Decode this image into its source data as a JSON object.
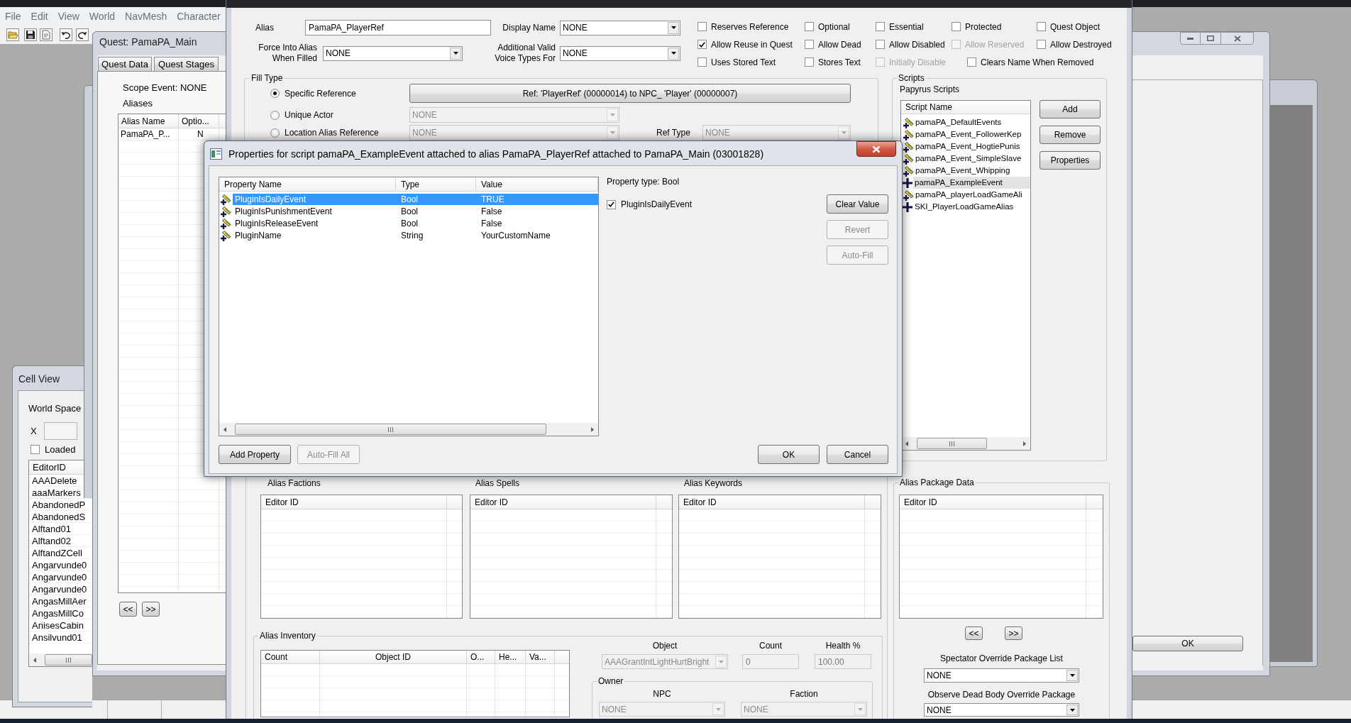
{
  "main_window": {
    "menu": [
      "File",
      "Edit",
      "View",
      "World",
      "NavMesh",
      "Character"
    ]
  },
  "cell_view": {
    "title": "Cell View",
    "world_space_label": "World Space",
    "x_label": "X",
    "loaded_checkbox": {
      "label": "Loaded",
      "checked": false
    },
    "list": {
      "column": "EditorID",
      "rows": [
        "AAADelete",
        "aaaMarkers",
        "AbandonedP",
        "AbandonedS",
        "Alftand01",
        "Alftand02",
        "AlftandZCell",
        "Angarvunde0",
        "Angarvunde0",
        "Angarvunde0",
        "AngasMillAer",
        "AngasMillCo",
        "AnisesCabin",
        "Ansilvund01"
      ]
    }
  },
  "quest_window": {
    "title": "Quest: PamaPA_Main",
    "tabs": [
      {
        "label": "Quest Data",
        "selected": false
      },
      {
        "label": "Quest Stages",
        "selected": false
      }
    ],
    "scope_event": "Scope Event: NONE",
    "aliases_label": "Aliases",
    "aliases_table": {
      "columns": [
        "Alias Name",
        "Optio..."
      ],
      "rows": [
        [
          "PamaPA_P...",
          "N"
        ]
      ]
    },
    "nav_buttons": [
      "<<",
      ">>"
    ],
    "ok_button": "OK"
  },
  "alias_window": {
    "alias": {
      "label": "Alias",
      "value": "PamaPA_PlayerRef"
    },
    "display_name": {
      "label": "Display Name",
      "value": "NONE",
      "disabled": false
    },
    "force_into_alias": {
      "label_lines": [
        "Force Into Alias",
        "When Filled"
      ],
      "value": "NONE",
      "disabled": false
    },
    "voice_types": {
      "label_lines": [
        "Additional Valid",
        "Voice Types For"
      ],
      "value": "NONE",
      "disabled": false
    },
    "flags": [
      [
        {
          "label": "Reserves Reference",
          "checked": false,
          "disabled": false
        },
        {
          "label": "Optional",
          "checked": false,
          "disabled": false
        },
        {
          "label": "Essential",
          "checked": false,
          "disabled": false
        },
        {
          "label": "Protected",
          "checked": false,
          "disabled": false
        },
        {
          "label": "Quest Object",
          "checked": false,
          "disabled": false
        }
      ],
      [
        {
          "label": "Allow Reuse in Quest",
          "checked": true,
          "disabled": false
        },
        {
          "label": "Allow Dead",
          "checked": false,
          "disabled": false
        },
        {
          "label": "Allow Disabled",
          "checked": false,
          "disabled": false
        },
        {
          "label": "Allow Reserved",
          "checked": false,
          "disabled": true
        },
        {
          "label": "Allow Destroyed",
          "checked": false,
          "disabled": false
        }
      ],
      [
        {
          "label": "Uses Stored Text",
          "checked": false,
          "disabled": false
        },
        {
          "label": "Stores Text",
          "checked": false,
          "disabled": false
        },
        {
          "label": "Initially Disable",
          "checked": false,
          "disabled": true
        },
        {
          "label": "Clears Name When Removed",
          "checked": false,
          "disabled": false
        }
      ]
    ],
    "fill_type": {
      "title": "Fill Type",
      "options": [
        {
          "label": "Specific Reference",
          "selected": true,
          "control": {
            "kind": "button",
            "text": "Ref: 'PlayerRef' (00000014) to NPC_ 'Player' (00000007)"
          }
        },
        {
          "label": "Unique Actor",
          "selected": false,
          "control": {
            "kind": "combo",
            "value": "NONE",
            "disabled": true
          }
        },
        {
          "label": "Location Alias Reference",
          "selected": false,
          "control": {
            "kind": "combo",
            "value": "NONE",
            "disabled": true
          },
          "ref_type": {
            "label": "Ref Type",
            "value": "NONE",
            "disabled": true
          }
        }
      ]
    },
    "scripts": {
      "title": "Scripts",
      "subtitle": "Papyrus Scripts",
      "column": "Script Name",
      "items": [
        {
          "name": "pamaPA_DefaultEvents",
          "properties_set": true,
          "selected": false
        },
        {
          "name": "pamaPA_Event_FollowerKep",
          "properties_set": true,
          "selected": false
        },
        {
          "name": "pamaPA_Event_HogtiePunis",
          "properties_set": true,
          "selected": false
        },
        {
          "name": "pamaPA_Event_SimpleSlave",
          "properties_set": true,
          "selected": false
        },
        {
          "name": "pamaPA_Event_Whipping",
          "properties_set": true,
          "selected": false
        },
        {
          "name": "pamaPA_ExampleEvent",
          "properties_set": false,
          "selected": true
        },
        {
          "name": "pamaPA_playerLoadGameAli",
          "properties_set": true,
          "selected": false
        },
        {
          "name": "SKI_PlayerLoadGameAlias",
          "properties_set": false,
          "selected": false
        }
      ],
      "buttons": [
        "Add",
        "Remove",
        "Properties"
      ]
    },
    "factions": {
      "label": "Alias Factions",
      "column": "Editor ID"
    },
    "spells": {
      "label": "Alias Spells",
      "column": "Editor ID"
    },
    "keywords": {
      "label": "Alias Keywords",
      "column": "Editor ID"
    },
    "inventory": {
      "title": "Alias Inventory",
      "columns": [
        "Count",
        "Object ID",
        "O...",
        "He...",
        "Va..."
      ],
      "object": {
        "label": "Object",
        "value": "AAAGrantIntLightHurtBright",
        "disabled": true
      },
      "count": {
        "label": "Count",
        "value": "0",
        "disabled": true
      },
      "health": {
        "label": "Health %",
        "value": "100.00",
        "disabled": true
      },
      "owner": {
        "title": "Owner",
        "npc": {
          "label": "NPC",
          "value": "NONE",
          "disabled": true
        },
        "faction": {
          "label": "Faction",
          "value": "NONE",
          "disabled": true
        }
      }
    },
    "package_data": {
      "title": "Alias Package Data",
      "column": "Editor ID",
      "nav_buttons": [
        "<<",
        ">>"
      ],
      "spectator": {
        "label": "Spectator Override Package List",
        "value": "NONE",
        "disabled": false
      },
      "observe": {
        "label": "Observe Dead Body Override Package",
        "value": "NONE",
        "disabled": false
      }
    }
  },
  "properties_dialog": {
    "title": "Properties for script pamaPA_ExampleEvent attached to alias PamaPA_PlayerRef attached to PamaPA_Main (03001828)",
    "columns": [
      "Property Name",
      "Type",
      "Value"
    ],
    "rows": [
      {
        "name": "PluginIsDailyEvent",
        "type": "Bool",
        "value": "TRUE",
        "selected": true,
        "value_set": true
      },
      {
        "name": "PluginIsPunishmentEvent",
        "type": "Bool",
        "value": "False",
        "selected": false,
        "value_set": true
      },
      {
        "name": "PluginIsReleaseEvent",
        "type": "Bool",
        "value": "False",
        "selected": false,
        "value_set": true
      },
      {
        "name": "PluginName",
        "type": "String",
        "value": "YourCustomName",
        "selected": false,
        "value_set": true
      }
    ],
    "property_type": "Property type: Bool",
    "value_checkbox": {
      "label": "PluginIsDailyEvent",
      "checked": true
    },
    "side_buttons": [
      {
        "label": "Clear Value",
        "disabled": false
      },
      {
        "label": "Revert",
        "disabled": true
      },
      {
        "label": "Auto-Fill",
        "disabled": true
      }
    ],
    "bottom_buttons": [
      {
        "label": "Add Property",
        "disabled": false
      },
      {
        "label": "Auto-Fill All",
        "disabled": true
      }
    ],
    "ok_button": "OK",
    "cancel_button": "Cancel"
  }
}
